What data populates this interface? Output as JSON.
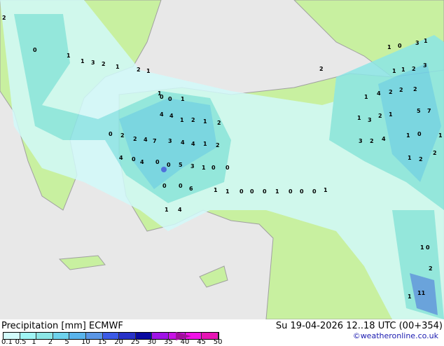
{
  "title": "Precipitation [mm]  ECMWF",
  "valid_time": "Su 19-04-2026 12..18 UTC (00+354)",
  "credit": "©weatheronline.co.uk",
  "legend": {
    "ticks": [
      "0.1",
      "0.5",
      "1",
      "2",
      "5",
      "10",
      "15",
      "20",
      "25",
      "30",
      "35",
      "40",
      "45",
      "50"
    ],
    "colors": [
      "#d2fafa",
      "#a0f5f5",
      "#8ce6e6",
      "#6ed2ec",
      "#5ab4ec",
      "#5a96e6",
      "#3c5ae6",
      "#2832c8",
      "#0a0aa0",
      "#a014e6",
      "#c814e6",
      "#f014e6",
      "#e614b4",
      "#a0109a"
    ]
  },
  "colors": {
    "sea": "#e8e8e8",
    "land": "#c8f0a0",
    "border": "#a0a0a0"
  },
  "map_labels": [
    "2",
    "0",
    "1",
    "1",
    "3",
    "2",
    "1",
    "2",
    "1",
    "1",
    "0",
    "0",
    "1",
    "4",
    "4",
    "1",
    "2",
    "1",
    "2",
    "0",
    "2",
    "2",
    "4",
    "7",
    "3",
    "4",
    "4",
    "1",
    "2",
    "4",
    "0",
    "4",
    "0",
    "0",
    "5",
    "3",
    "1",
    "0",
    "0",
    "0",
    "0",
    "6",
    "1",
    "4",
    "1",
    "1",
    "0",
    "0",
    "0",
    "1",
    "0",
    "0",
    "0",
    "1",
    "2",
    "1",
    "4",
    "2",
    "2",
    "2",
    "1",
    "3",
    "2",
    "1",
    "5",
    "7",
    "3",
    "2",
    "4",
    "1",
    "0",
    "1",
    "2",
    "2",
    "1",
    "1",
    "2",
    "3",
    "1",
    "0",
    "3",
    "1",
    "2",
    "11",
    "1",
    "1",
    "0",
    "1"
  ]
}
